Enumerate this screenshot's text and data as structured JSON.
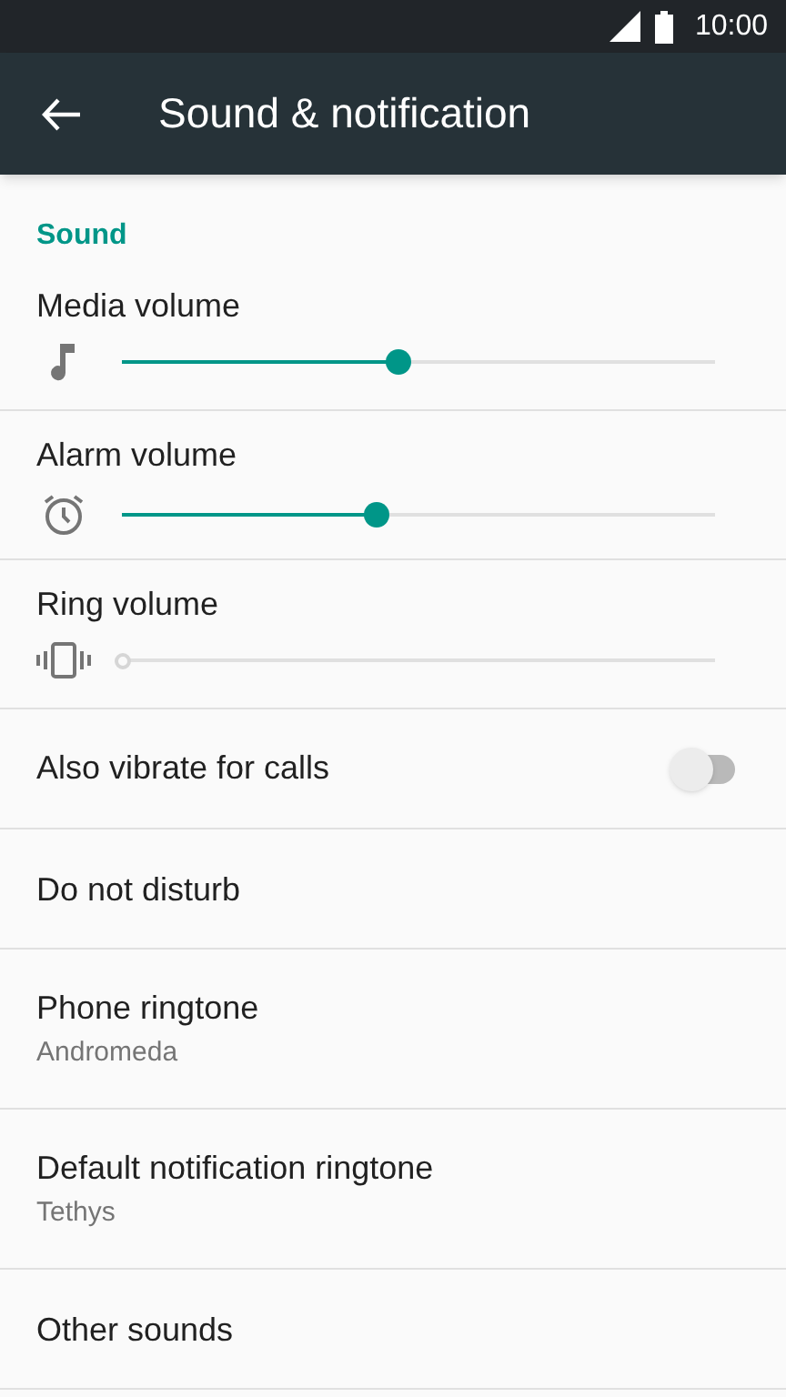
{
  "status_bar": {
    "time": "10:00"
  },
  "app_bar": {
    "title": "Sound & notification"
  },
  "section": {
    "title": "Sound"
  },
  "items": [
    {
      "kind": "slider",
      "label": "Media volume",
      "level": 0.466
    },
    {
      "kind": "slider",
      "label": "Alarm volume",
      "level": 0.43
    },
    {
      "kind": "slider",
      "label": "Ring volume",
      "level": 0
    },
    {
      "kind": "toggle",
      "label": "Also vibrate for calls",
      "on": false
    },
    {
      "kind": "plain",
      "label": "Do not disturb"
    },
    {
      "kind": "plain",
      "label": "Phone ringtone",
      "summary": "Andromeda"
    },
    {
      "kind": "plain",
      "label": "Default notification ringtone",
      "summary": "Tethys"
    },
    {
      "kind": "plain",
      "label": "Other sounds"
    }
  ]
}
